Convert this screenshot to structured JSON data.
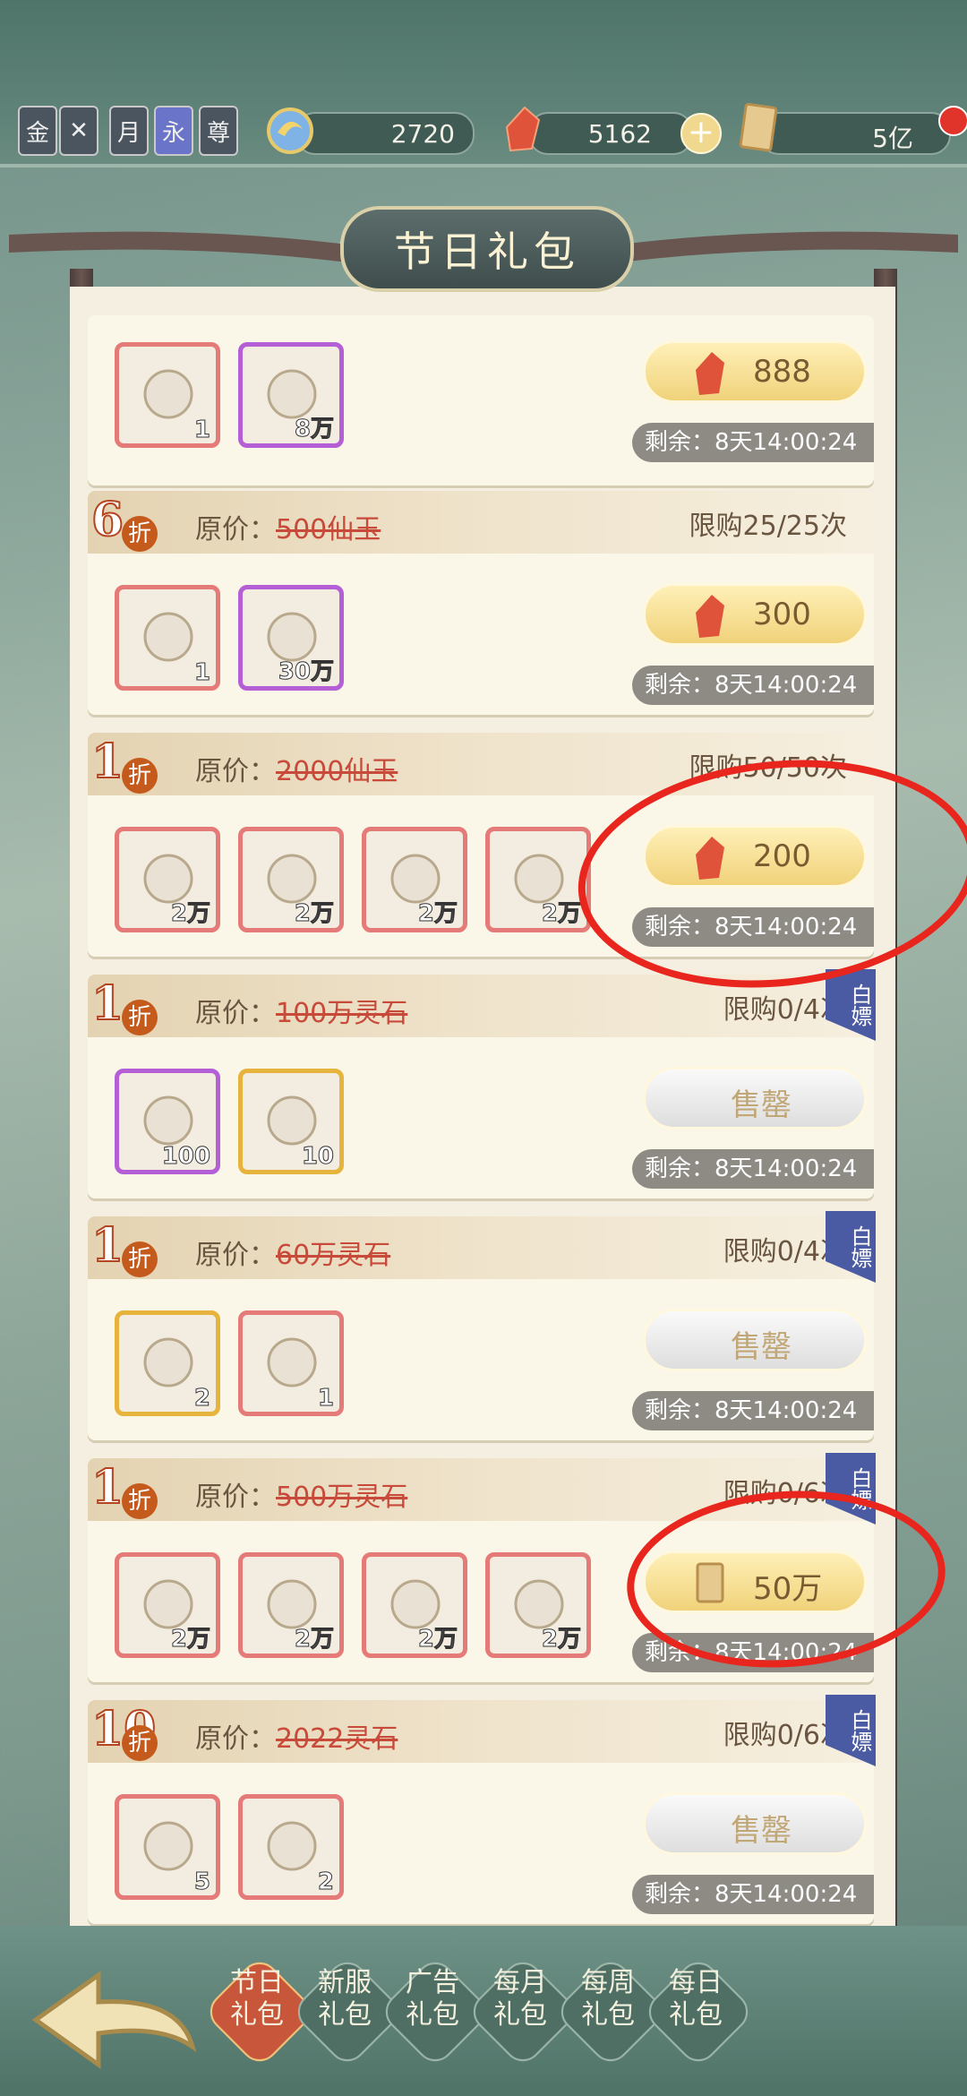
{
  "header": {
    "badges": [
      "金",
      "",
      "月",
      "永",
      "尊"
    ],
    "currencies": [
      {
        "name": "spirit-coin",
        "value": "2720"
      },
      {
        "name": "jade",
        "value": "5162"
      },
      {
        "name": "spirit-stone",
        "value": "5亿"
      }
    ]
  },
  "title": "节日礼包",
  "cards": [
    {
      "discount": "",
      "orig_label": "",
      "orig_price": "",
      "limit": "",
      "ribbon": "",
      "items": [
        {
          "q": "1",
          "frame": "red"
        },
        {
          "q": "8万",
          "frame": "purple"
        }
      ],
      "price": "888",
      "price_type": "jade",
      "timer": "剩余：8天14:00:24"
    },
    {
      "discount": "6",
      "orig_label": "原价：",
      "orig_price": "500仙玉",
      "limit": "限购25/25次",
      "ribbon": "",
      "items": [
        {
          "q": "1",
          "frame": "red"
        },
        {
          "q": "30万",
          "frame": "purple"
        }
      ],
      "price": "300",
      "price_type": "jade",
      "timer": "剩余：8天14:00:24"
    },
    {
      "discount": "1",
      "orig_label": "原价：",
      "orig_price": "2000仙玉",
      "limit": "限购50/50次",
      "ribbon": "",
      "items": [
        {
          "q": "2万",
          "frame": "red"
        },
        {
          "q": "2万",
          "frame": "red"
        },
        {
          "q": "2万",
          "frame": "red"
        },
        {
          "q": "2万",
          "frame": "red"
        }
      ],
      "price": "200",
      "price_type": "jade",
      "timer": "剩余：8天14:00:24"
    },
    {
      "discount": "1",
      "orig_label": "原价：",
      "orig_price": "100万灵石",
      "limit": "限购0/4次",
      "ribbon": "白嫖",
      "items": [
        {
          "q": "100",
          "frame": "purple"
        },
        {
          "q": "10",
          "frame": "gold"
        }
      ],
      "price": "售罄",
      "price_type": "sold",
      "timer": "剩余：8天14:00:24"
    },
    {
      "discount": "1",
      "orig_label": "原价：",
      "orig_price": "60万灵石",
      "limit": "限购0/4次",
      "ribbon": "白嫖",
      "items": [
        {
          "q": "2",
          "frame": "gold"
        },
        {
          "q": "1",
          "frame": "red"
        }
      ],
      "price": "售罄",
      "price_type": "sold",
      "timer": "剩余：8天14:00:24"
    },
    {
      "discount": "1",
      "orig_label": "原价：",
      "orig_price": "500万灵石",
      "limit": "限购0/6次",
      "ribbon": "白嫖",
      "items": [
        {
          "q": "2万",
          "frame": "red"
        },
        {
          "q": "2万",
          "frame": "red"
        },
        {
          "q": "2万",
          "frame": "red"
        },
        {
          "q": "2万",
          "frame": "red"
        }
      ],
      "price": "50万",
      "price_type": "stone",
      "timer": "剩余：8天14:00:24"
    },
    {
      "discount": "10",
      "orig_label": "原价：",
      "orig_price": "2022灵石",
      "limit": "限购0/6次",
      "ribbon": "白嫖",
      "items": [
        {
          "q": "5",
          "frame": "red"
        },
        {
          "q": "2",
          "frame": "red"
        }
      ],
      "price": "售罄",
      "price_type": "sold",
      "timer": "剩余：8天14:00:24"
    }
  ],
  "discount_suffix": "折",
  "tabs": [
    {
      "l1": "节日",
      "l2": "礼包",
      "active": true
    },
    {
      "l1": "新服",
      "l2": "礼包",
      "active": false
    },
    {
      "l1": "广告",
      "l2": "礼包",
      "active": false
    },
    {
      "l1": "每月",
      "l2": "礼包",
      "active": false
    },
    {
      "l1": "每周",
      "l2": "礼包",
      "active": false
    },
    {
      "l1": "每日",
      "l2": "礼包",
      "active": false
    }
  ],
  "colors": {
    "accent": "#e8261d",
    "panel": "#fbf7e8",
    "sold": "#c1a676"
  }
}
